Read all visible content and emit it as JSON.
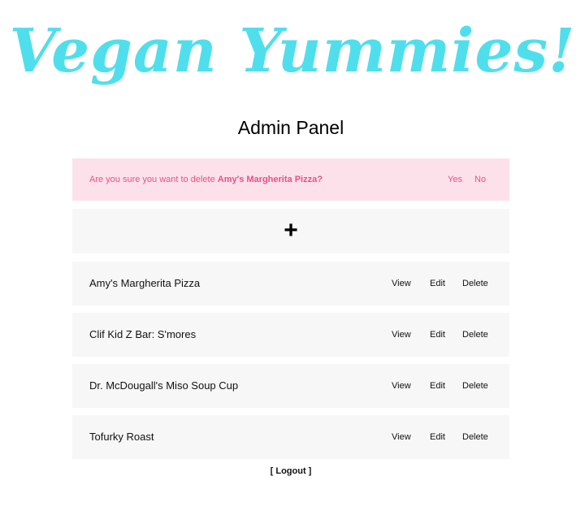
{
  "header": {
    "logo_text": "Vegan Yummies!",
    "page_title": "Admin Panel"
  },
  "confirm": {
    "message": "Are you sure you want to delete ",
    "item_name": "Amy's Margherita Pizza?",
    "yes_label": "Yes",
    "no_label": "No"
  },
  "add": {
    "label": "+"
  },
  "items": [
    {
      "name": "Amy's Margherita Pizza",
      "view": "View",
      "edit": "Edit",
      "delete": "Delete"
    },
    {
      "name": "Clif Kid Z Bar: S'mores",
      "view": "View",
      "edit": "Edit",
      "delete": "Delete"
    },
    {
      "name": "Dr. McDougall's Miso Soup Cup",
      "view": "View",
      "edit": "Edit",
      "delete": "Delete"
    },
    {
      "name": "Tofurky Roast",
      "view": "View",
      "edit": "Edit",
      "delete": "Delete"
    }
  ],
  "footer": {
    "bracket_open": "[ ",
    "logout_label": "Logout",
    "bracket_close": " ]"
  },
  "colors": {
    "brand": "#4fdfec",
    "alert_bg": "#fde1ea",
    "alert_text": "#ec4f86",
    "row_bg": "#f7f7f7"
  }
}
